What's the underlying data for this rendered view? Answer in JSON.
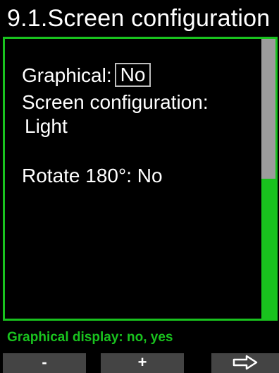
{
  "header": {
    "title": "9.1.Screen configuration"
  },
  "settings": {
    "graphical_label": "Graphical:",
    "graphical_value": "No",
    "screen_config_label": "Screen configuration:",
    "screen_config_value": "Light",
    "rotate_label": "Rotate 180°:",
    "rotate_value": "No"
  },
  "scrollbar": {
    "position_fraction": 0.5
  },
  "hint": {
    "text": "Graphical display: no, yes"
  },
  "softkeys": {
    "minus_label": "-",
    "plus_label": "+",
    "next_icon": "right-arrow-icon"
  },
  "colors": {
    "accent": "#19c21e",
    "scroll_thumb": "#9c9c9c",
    "softkey_bg": "#444444",
    "background": "#000000"
  }
}
